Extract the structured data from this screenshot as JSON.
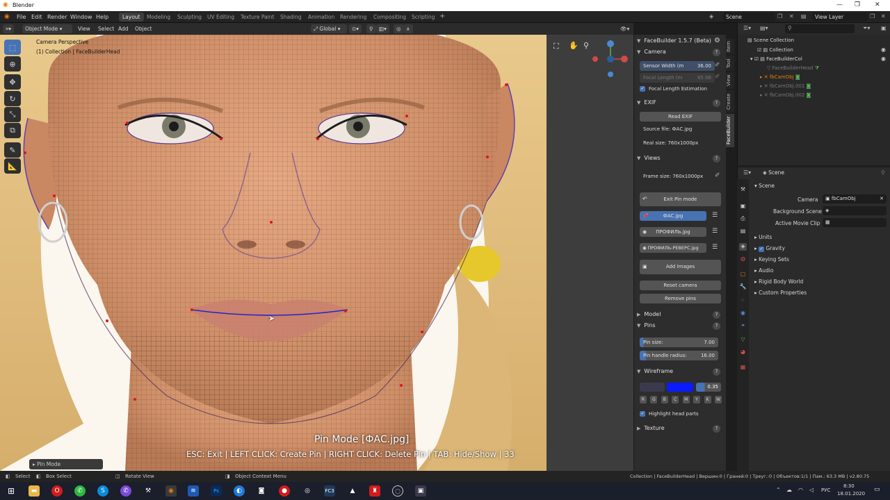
{
  "window": {
    "title": "Blender"
  },
  "menu": [
    "File",
    "Edit",
    "Render",
    "Window",
    "Help"
  ],
  "workspaces": [
    "Layout",
    "Modeling",
    "Sculpting",
    "UV Editing",
    "Texture Paint",
    "Shading",
    "Animation",
    "Rendering",
    "Compositing",
    "Scripting"
  ],
  "active_workspace": "Layout",
  "scene_field": "Scene",
  "view_layer_field": "View Layer",
  "viewport_header": {
    "mode": "Object Mode",
    "view": "View",
    "select": "Select",
    "add": "Add",
    "object": "Object",
    "orientation": "Global"
  },
  "viewport": {
    "camera_label": "Camera Perspective",
    "collection_label": "(1) Collection | FaceBuilderHead",
    "pin_mode_title": "Pin Mode  [ФАС.jpg]",
    "pin_mode_help": "ESC: Exit | LEFT CLICK: Create Pin | RIGHT CLICK: Delete Pin | TAB: Hide/Show | 33",
    "operator_panel": "Pin Mode"
  },
  "npanel": {
    "title": "FaceBuilder 1.5.7 (Beta)",
    "camera": {
      "header": "Camera",
      "sensor_width_label": "Sensor Width (m",
      "sensor_width_value": "36.00",
      "focal_length_label": "Focal Length (m",
      "focal_length_value": "85.06",
      "focal_estimation": "Focal Length Estimation"
    },
    "exif": {
      "header": "EXIF",
      "read_button": "Read EXIF",
      "source_file": "Source file: ФАС.jpg",
      "real_size": "Real size: 760x1000px"
    },
    "views": {
      "header": "Views",
      "frame_size": "Frame size: 760x1000px",
      "exit_pin_mode": "Exit Pin mode",
      "images": [
        "ФАС.jpg",
        "ПРОФИЛЬ.jpg",
        "ПРОФИЛЬ-РЕВЕРС.jpg"
      ],
      "add_images": "Add Images",
      "reset_camera": "Reset camera",
      "remove_pins": "Remove pins"
    },
    "model": {
      "header": "Model"
    },
    "pins": {
      "header": "Pins",
      "pin_size_label": "Pin size:",
      "pin_size_value": "7.00",
      "handle_radius_label": "Pin handle radius:",
      "handle_radius_value": "16.00"
    },
    "wireframe": {
      "header": "Wireframe",
      "opacity": "0.35",
      "buttons": [
        "R",
        "G",
        "B",
        "C",
        "M",
        "Y",
        "K",
        "W"
      ],
      "highlight": "Highlight head parts",
      "color1": "#3a3a4e",
      "color2": "#0a1cff"
    },
    "texture": {
      "header": "Texture"
    },
    "tabs": [
      "Item",
      "Tool",
      "View",
      "Create",
      "FaceBuilder"
    ]
  },
  "outliner": {
    "root": "Scene Collection",
    "items": [
      "Collection",
      "FaceBuilderCol",
      "FaceBuilderHead",
      "fbCamObj",
      "fbCamObj.001",
      "fbCamObj.002"
    ]
  },
  "properties": {
    "breadcrumb": "Scene",
    "section": "Scene",
    "camera_label": "Camera",
    "camera_value": "fbCamObj",
    "background_scene": "Background Scene",
    "active_movie_clip": "Active Movie Clip",
    "panels": [
      "Units",
      "Gravity",
      "Keying Sets",
      "Audio",
      "Rigid Body World",
      "Custom Properties"
    ]
  },
  "statusbar": {
    "select": "Select",
    "box_select": "Box Select",
    "rotate_view": "Rotate View",
    "context_menu": "Object Context Menu",
    "stats": "Collection | FaceBuilderHead | Вершин:0 | Граней:0 | Треуг.:0 | Объектов:1/1 | Пам.: 63.3 MB | v2.80.75"
  },
  "taskbar": {
    "lang": "РУС",
    "time": "8:30",
    "date": "18.01.2020"
  },
  "colors": {
    "accent": "#4772b3",
    "pin": "#e0141b",
    "wire": "#5a3a8c"
  }
}
